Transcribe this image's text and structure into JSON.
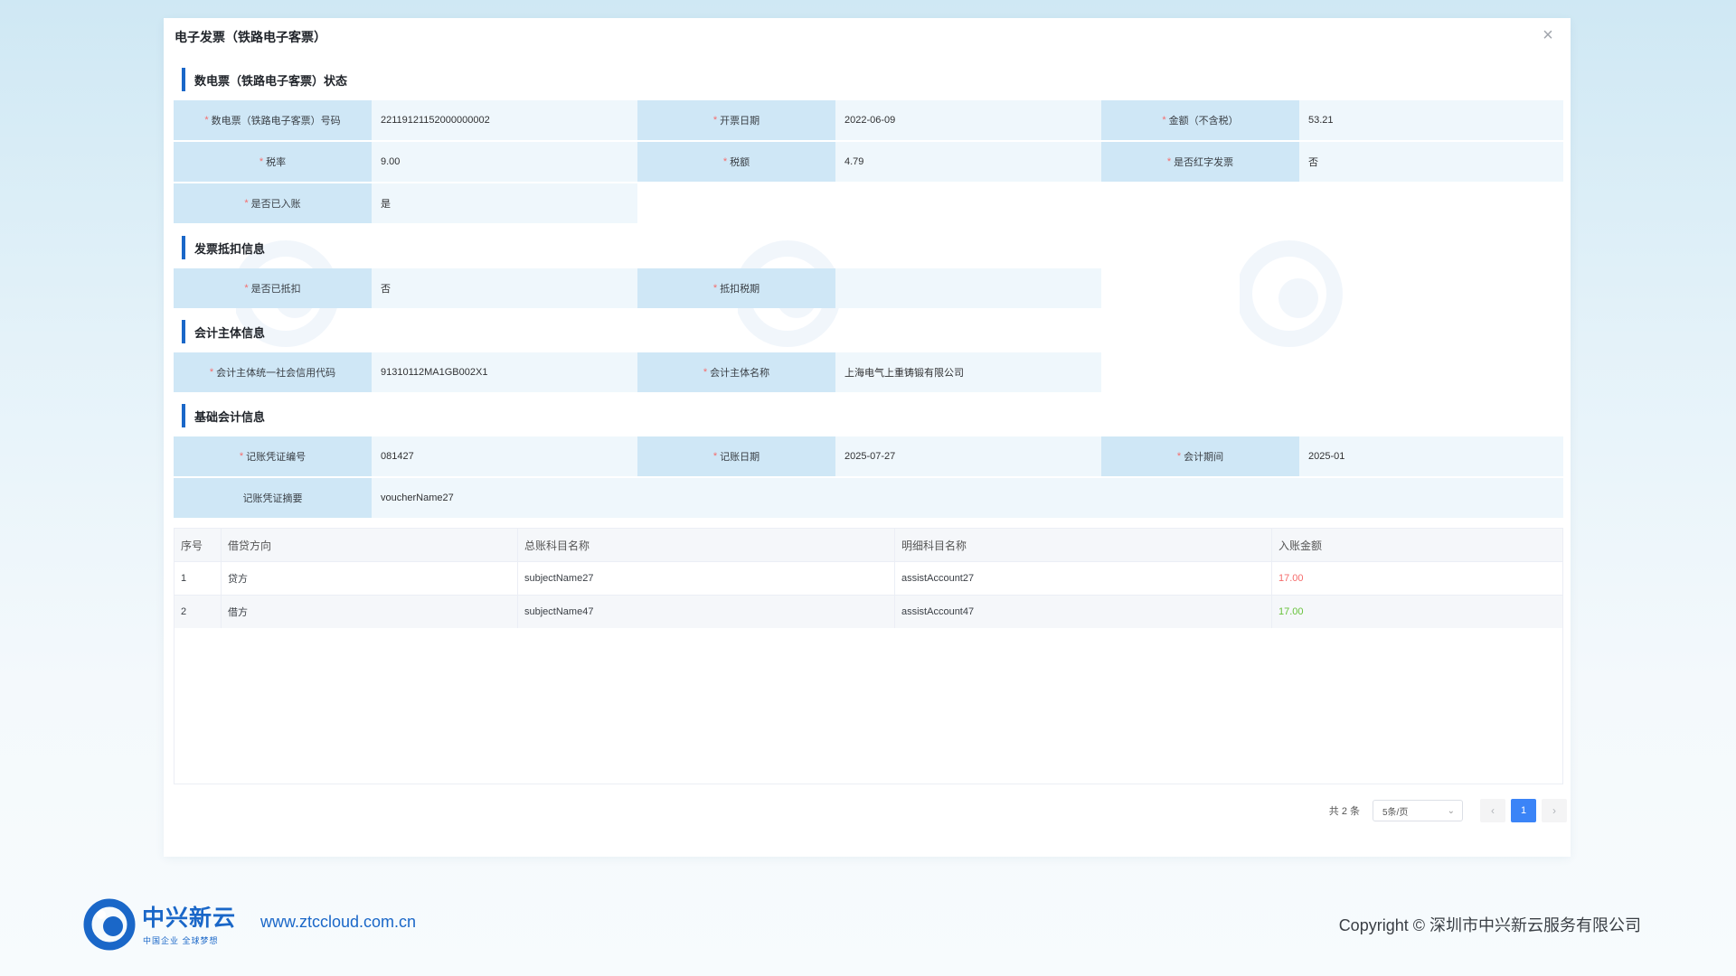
{
  "dialog": {
    "title": "电子发票（铁路电子客票）",
    "close_symbol": "×"
  },
  "sections": {
    "status": {
      "title": "数电票（铁路电子客票）状态",
      "rows": [
        [
          {
            "label": "数电票（铁路电子客票）号码",
            "required": true,
            "value": "22119121152000000002"
          },
          {
            "label": "开票日期",
            "required": true,
            "value": "2022-06-09"
          },
          {
            "label": "金额（不含税）",
            "required": true,
            "value": "53.21"
          }
        ],
        [
          {
            "label": "税率",
            "required": true,
            "value": "9.00"
          },
          {
            "label": "税额",
            "required": true,
            "value": "4.79"
          },
          {
            "label": "是否红字发票",
            "required": true,
            "value": "否"
          }
        ],
        [
          {
            "label": "是否已入账",
            "required": true,
            "value": "是"
          }
        ]
      ]
    },
    "deduction": {
      "title": "发票抵扣信息",
      "rows": [
        [
          {
            "label": "是否已抵扣",
            "required": true,
            "value": "否"
          },
          {
            "label": "抵扣税期",
            "required": true,
            "value": ""
          }
        ]
      ]
    },
    "entity": {
      "title": "会计主体信息",
      "rows": [
        [
          {
            "label": "会计主体统一社会信用代码",
            "required": true,
            "value": "91310112MA1GB002X1"
          },
          {
            "label": "会计主体名称",
            "required": true,
            "value": "上海电气上重铸锻有限公司"
          }
        ]
      ]
    },
    "accounting": {
      "title": "基础会计信息",
      "rows": [
        [
          {
            "label": "记账凭证编号",
            "required": true,
            "value": "081427"
          },
          {
            "label": "记账日期",
            "required": true,
            "value": "2025-07-27"
          },
          {
            "label": "会计期间",
            "required": true,
            "value": "2025-01"
          }
        ],
        [
          {
            "label": "记账凭证摘要",
            "required": false,
            "value": "voucherName27"
          }
        ]
      ]
    }
  },
  "table": {
    "columns": [
      "序号",
      "借贷方向",
      "总账科目名称",
      "明细科目名称",
      "入账金额"
    ],
    "rows": [
      {
        "index": "1",
        "direction": "贷方",
        "subject": "subjectName27",
        "assist": "assistAccount27",
        "amount": "17.00",
        "amount_color": "#f56c6c"
      },
      {
        "index": "2",
        "direction": "借方",
        "subject": "subjectName47",
        "assist": "assistAccount47",
        "amount": "17.00",
        "amount_color": "#67c23a"
      }
    ]
  },
  "pagination": {
    "total_text": "共 2 条",
    "page_size": "5条/页",
    "prev_symbol": "‹",
    "next_symbol": "›",
    "current_page": "1"
  },
  "footer": {
    "logo_name": "中兴新云",
    "logo_slogan": "中国企业 全球梦想",
    "url": "www.ztccloud.com.cn",
    "copyright": "Copyright © 深圳市中兴新云服务有限公司"
  },
  "colors": {
    "brand": "#1a67c8",
    "label_bg": "#cfe7f6",
    "value_bg": "#eff7fc",
    "pager_active": "#3b84f7"
  }
}
